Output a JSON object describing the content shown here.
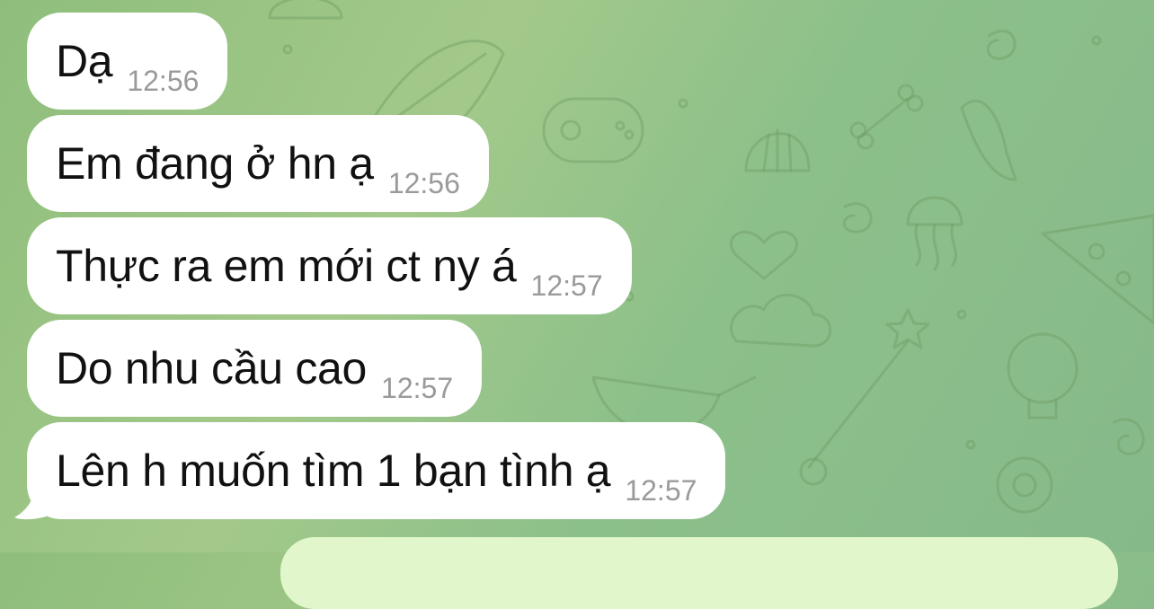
{
  "messages": [
    {
      "text": "Dạ",
      "time": "12:56"
    },
    {
      "text": "Em đang ở hn ạ",
      "time": "12:56"
    },
    {
      "text": "Thực ra em mới ct ny á",
      "time": "12:57"
    },
    {
      "text": "Do nhu cầu cao",
      "time": "12:57"
    },
    {
      "text": "Lên h muốn tìm 1 bạn tình ạ",
      "time": "12:57"
    }
  ],
  "colors": {
    "incoming_bubble": "#ffffff",
    "outgoing_bubble": "#e1f7cb",
    "timestamp": "#9a9a9a",
    "wallpaper": "#95c282"
  }
}
